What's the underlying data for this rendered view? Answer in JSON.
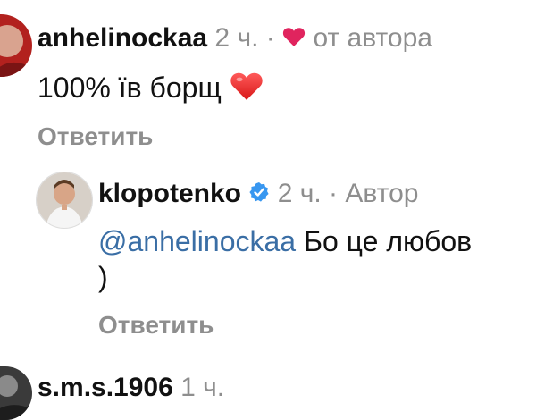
{
  "colors": {
    "muted": "#8e8e8e",
    "mention": "#3a6ea5",
    "heart": "#e0245e",
    "verified": "#3897f0"
  },
  "comments": [
    {
      "username": "anhelinockaa",
      "time": "2 ч.",
      "separator": "·",
      "liked_badge_icon": "heart-icon",
      "liked_by_author_label": "от автора",
      "text": "100% їв борщ",
      "text_emoji": "red-heart-emoji",
      "reply_label": "Ответить"
    }
  ],
  "reply": {
    "username": "klopotenko",
    "verified_icon": "verified-badge-icon",
    "time": "2 ч.",
    "separator": "·",
    "role_label": "Автор",
    "mention": "@anhelinockaa",
    "text_line1": " Бо це любов",
    "text_line2": ")",
    "reply_label": "Ответить"
  },
  "next_comment": {
    "username": "s.m.s.1906",
    "time": "1 ч."
  }
}
